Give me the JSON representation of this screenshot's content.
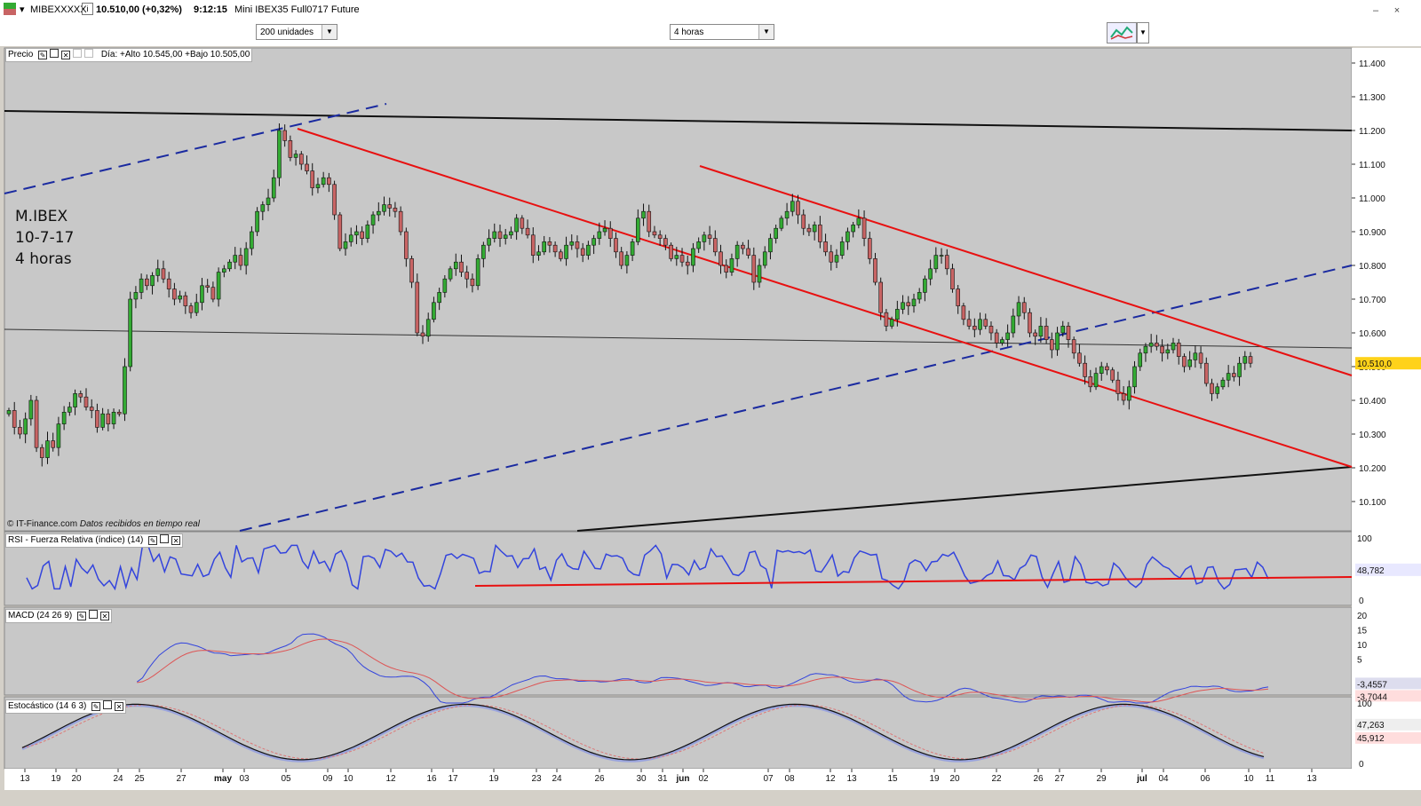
{
  "titlebar": {
    "symbol": "MIBEXXXXX",
    "price": "10.510,00 (+0,32%)",
    "time": "9:12:15",
    "name": "Mini IBEX35 Full0717 Future"
  },
  "toolbar": {
    "units": "200 unidades",
    "interval": "4 horas"
  },
  "price_panel": {
    "label": "Precio",
    "info": "Día: +Alto 10.545,00 +Bajo 10.505,00",
    "annotation": [
      "M.IBEX",
      "10-7-17",
      "4 horas"
    ],
    "copyright": "© IT-Finance.com",
    "realtime": "Datos recibidos en tiempo real",
    "current_value": "10.510,0"
  },
  "rsi_panel": {
    "label": "RSI - Fuerza Relativa (índice) (14)",
    "value": "48,782"
  },
  "macd_panel": {
    "label": "MACD (24 26 9)",
    "value1": "-3,4557",
    "value2": "-3,7044"
  },
  "stoch_panel": {
    "label": "Estocástico (14 6 3)",
    "value1": "47,263",
    "value2": "45,912"
  },
  "colors": {
    "bull": "#33aa33",
    "bear": "#c86464",
    "red_line": "#e81010",
    "blue_line": "#1a2aa0",
    "panel_bg": "#c8c8c8"
  },
  "chart_data": {
    "type": "candlestick",
    "y_axis_labels": [
      "11.400",
      "11.300",
      "11.200",
      "11.100",
      "11.000",
      "10.900",
      "10.800",
      "10.700",
      "10.600",
      "10.500",
      "10.400",
      "10.300",
      "10.200",
      "10.100"
    ],
    "ylim": [
      10050,
      11450
    ],
    "x_axis_labels": [
      "13",
      "19",
      "20",
      "24",
      "25",
      "27",
      "may",
      "03",
      "05",
      "09",
      "10",
      "12",
      "16",
      "17",
      "19",
      "23",
      "24",
      "26",
      "30",
      "31",
      "jun",
      "02",
      "07",
      "08",
      "12",
      "13",
      "15",
      "19",
      "20",
      "22",
      "26",
      "27",
      "29",
      "jul",
      "04",
      "06",
      "10",
      "11",
      "13"
    ],
    "closes": [
      10370,
      10320,
      10300,
      10345,
      10400,
      10260,
      10230,
      10280,
      10260,
      10330,
      10365,
      10380,
      10420,
      10410,
      10380,
      10370,
      10320,
      10360,
      10330,
      10365,
      10360,
      10500,
      10700,
      10720,
      10760,
      10740,
      10770,
      10790,
      10760,
      10730,
      10700,
      10710,
      10680,
      10660,
      10690,
      10740,
      10735,
      10700,
      10780,
      10790,
      10810,
      10830,
      10800,
      10850,
      10900,
      10960,
      10980,
      11000,
      11060,
      11200,
      11170,
      11120,
      11130,
      11100,
      11080,
      11030,
      11040,
      11060,
      11040,
      10950,
      10850,
      10870,
      10890,
      10900,
      10880,
      10920,
      10950,
      10960,
      10980,
      10970,
      10960,
      10900,
      10820,
      10750,
      10600,
      10590,
      10640,
      10690,
      10720,
      10760,
      10790,
      10810,
      10780,
      10760,
      10740,
      10820,
      10860,
      10880,
      10900,
      10880,
      10890,
      10900,
      10940,
      10910,
      10890,
      10830,
      10840,
      10870,
      10860,
      10840,
      10820,
      10860,
      10870,
      10850,
      10830,
      10860,
      10880,
      10900,
      10910,
      10880,
      10840,
      10800,
      10830,
      10870,
      10940,
      10960,
      10900,
      10890,
      10880,
      10860,
      10820,
      10830,
      10810,
      10800,
      10850,
      10870,
      10890,
      10880,
      10840,
      10800,
      10780,
      10820,
      10860,
      10850,
      10830,
      10750,
      10800,
      10840,
      10880,
      10910,
      10940,
      10960,
      10990,
      10950,
      10910,
      10900,
      10920,
      10870,
      10840,
      10810,
      10830,
      10870,
      10900,
      10920,
      10940,
      10880,
      10820,
      10750,
      10660,
      10620,
      10640,
      10670,
      10690,
      10680,
      10700,
      10720,
      10760,
      10790,
      10830,
      10830,
      10790,
      10730,
      10680,
      10640,
      10620,
      10610,
      10640,
      10620,
      10600,
      10570,
      10580,
      10600,
      10650,
      10690,
      10660,
      10600,
      10590,
      10620,
      10580,
      10550,
      10600,
      10620,
      10580,
      10540,
      10510,
      10470,
      10440,
      10480,
      10500,
      10490,
      10460,
      10420,
      10400,
      10440,
      10500,
      10540,
      10560,
      10570,
      10560,
      10540,
      10550,
      10570,
      10530,
      10500,
      10520,
      10540,
      10510,
      10450,
      10420,
      10440,
      10460,
      10480,
      10470,
      10510,
      10530,
      10510
    ]
  }
}
